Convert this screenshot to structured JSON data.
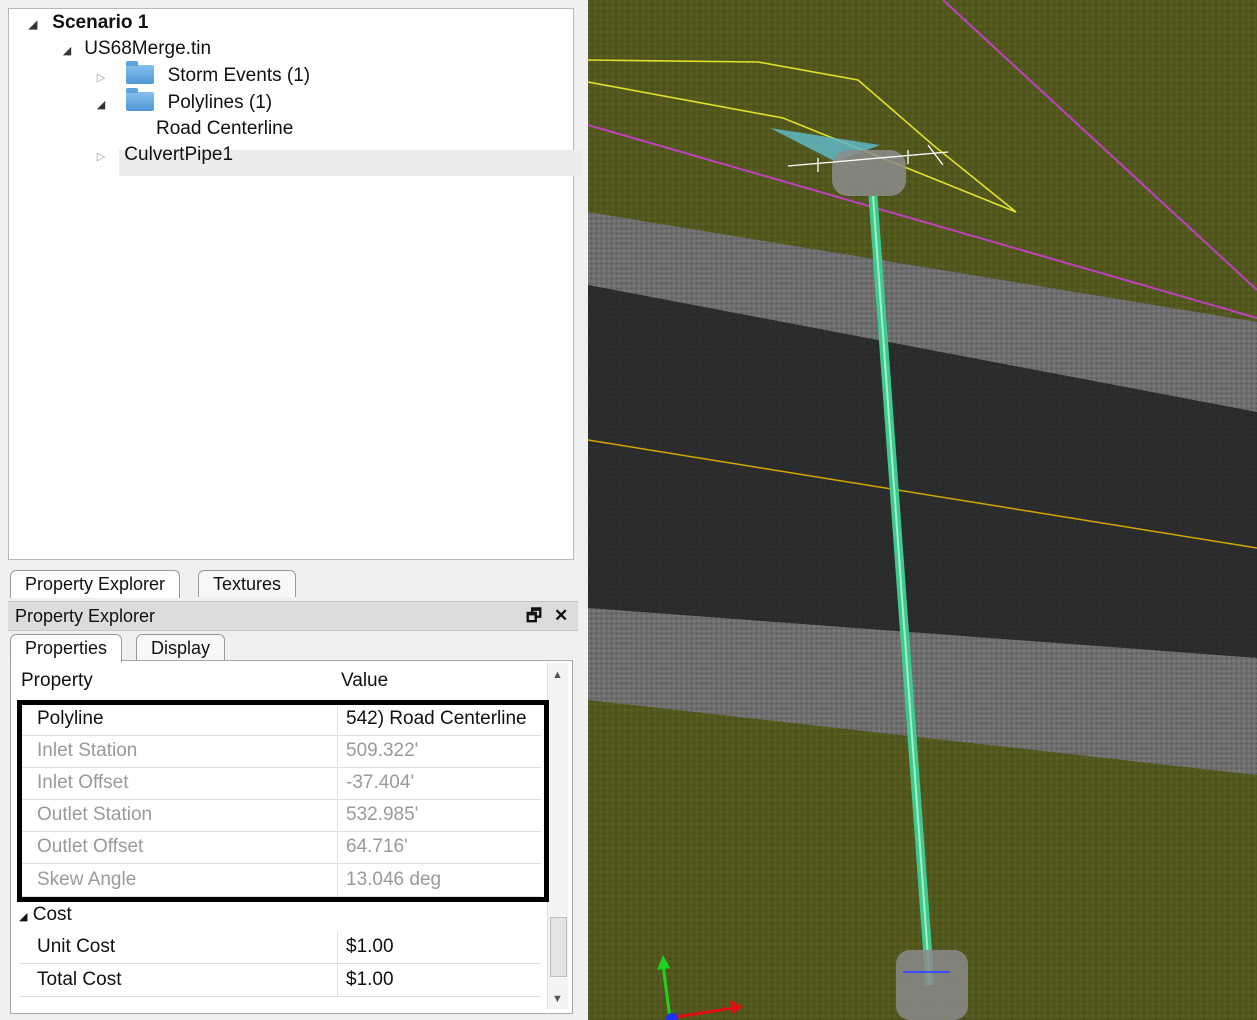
{
  "tree": {
    "scenario": "Scenario 1",
    "surface": "US68Merge.tin",
    "storm_events": "Storm Events (1)",
    "polylines": "Polylines (1)",
    "road_centerline": "Road Centerline",
    "culvert": "CulvertPipe1"
  },
  "bottom_tabs": [
    "Property Explorer",
    "Textures"
  ],
  "panel": {
    "title": "Property Explorer",
    "float_icon": "restore-icon",
    "close_icon": "close-icon"
  },
  "sub_tabs": [
    "Properties",
    "Display"
  ],
  "grid": {
    "headers": {
      "property": "Property",
      "value": "Value"
    },
    "rows": [
      {
        "property": "Polyline",
        "value": "542) Road Centerline",
        "readonly": false
      },
      {
        "property": "Inlet Station",
        "value": "509.322'",
        "readonly": true
      },
      {
        "property": "Inlet Offset",
        "value": "-37.404'",
        "readonly": true
      },
      {
        "property": "Outlet Station",
        "value": "532.985'",
        "readonly": true
      },
      {
        "property": "Outlet Offset",
        "value": "64.716'",
        "readonly": true
      },
      {
        "property": "Skew Angle",
        "value": "13.046 deg",
        "readonly": true
      }
    ],
    "category": "Cost",
    "cost_rows": [
      {
        "property": "Unit Cost",
        "value": "$1.00"
      },
      {
        "property": "Total Cost",
        "value": "$1.00"
      }
    ]
  },
  "colors": {
    "grass": "#52571e",
    "shoulder": "#6e6e6e",
    "asphalt": "#2a2b2b",
    "pipe": "#4fd6a0",
    "centerline": "#d6a600",
    "boundary": "#e1e12a",
    "magenta_line": "#c040c0"
  }
}
